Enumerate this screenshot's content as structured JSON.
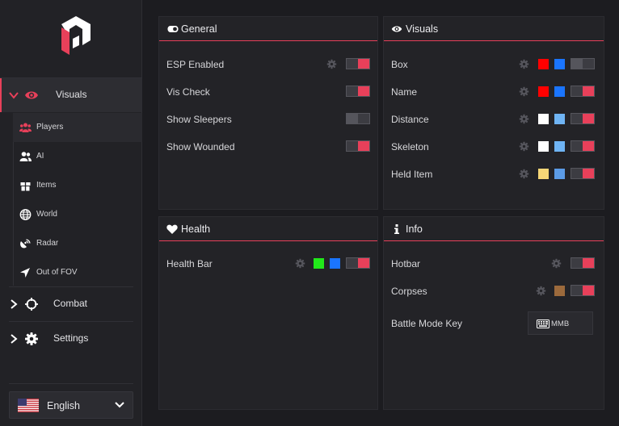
{
  "sidebar": {
    "main_items": [
      {
        "label": "Visuals"
      },
      {
        "label": "Combat"
      },
      {
        "label": "Settings"
      }
    ],
    "sub_items": [
      {
        "label": "Players"
      },
      {
        "label": "AI"
      },
      {
        "label": "Items"
      },
      {
        "label": "World"
      },
      {
        "label": "Radar"
      },
      {
        "label": "Out of FOV"
      }
    ],
    "language": {
      "label": "English"
    }
  },
  "panels": {
    "general": {
      "title": "General",
      "rows": [
        {
          "label": "ESP Enabled",
          "toggle": "on"
        },
        {
          "label": "Vis Check",
          "toggle": "on"
        },
        {
          "label": "Show Sleepers",
          "toggle": "off"
        },
        {
          "label": "Show Wounded",
          "toggle": "on"
        }
      ]
    },
    "visuals": {
      "title": "Visuals",
      "rows": [
        {
          "label": "Box",
          "colors": [
            "#ff0000",
            "#1a75ff"
          ],
          "toggle": "off"
        },
        {
          "label": "Name",
          "colors": [
            "#ff0000",
            "#1a75ff"
          ],
          "toggle": "on"
        },
        {
          "label": "Distance",
          "colors": [
            "#ffffff",
            "#6fb4f4"
          ],
          "toggle": "on"
        },
        {
          "label": "Skeleton",
          "colors": [
            "#ffffff",
            "#6fb4f4"
          ],
          "toggle": "on"
        },
        {
          "label": "Held Item",
          "colors": [
            "#f7d777",
            "#5b9be6"
          ],
          "toggle": "on"
        }
      ]
    },
    "health": {
      "title": "Health",
      "rows": [
        {
          "label": "Health Bar",
          "colors": [
            "#21e81a",
            "#1a75ff"
          ],
          "toggle": "on"
        }
      ]
    },
    "info": {
      "title": "Info",
      "rows": [
        {
          "label": "Hotbar",
          "toggle": "on"
        },
        {
          "label": "Corpses",
          "colors": [
            "#9c6a3c"
          ],
          "toggle": "on"
        },
        {
          "label": "Battle Mode Key",
          "key": "MMB"
        }
      ]
    }
  },
  "colors": {
    "accent": "#e8405a",
    "background": "#1c1c20",
    "panel": "#232327"
  }
}
